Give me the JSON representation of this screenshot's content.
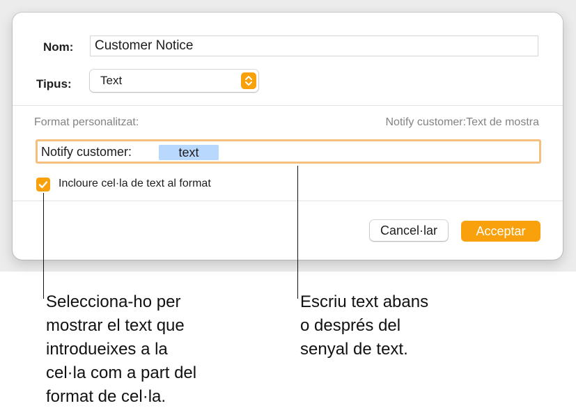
{
  "dialog": {
    "name_label": "Nom:",
    "name_value": "Customer Notice",
    "type_label": "Tipus:",
    "type_value": "Text",
    "custom_format_label": "Format personalitzat:",
    "preview_text": "Notify customer:Text de mostra",
    "format_prefix": "Notify customer: ",
    "format_token": "text",
    "include_checkbox_checked": true,
    "include_checkbox_label": "Incloure cel·la de text al format",
    "cancel_label": "Cancel·lar",
    "ok_label": "Acceptar"
  },
  "callouts": {
    "checkbox_note_lines": [
      "Selecciona-ho per",
      "mostrar el text que",
      "introdueixes a la",
      "cel·la com a part del",
      "format de cel·la."
    ],
    "field_note_lines": [
      "Escriu text abans",
      "o després del",
      "senyal de text."
    ]
  },
  "colors": {
    "accent": "#f8a10c",
    "focus_ring": "#f6bf7c",
    "token_bg": "#b8d8fd"
  },
  "icons": {
    "stepper": "chevron-up-down-icon",
    "checkbox": "checkmark-icon"
  }
}
